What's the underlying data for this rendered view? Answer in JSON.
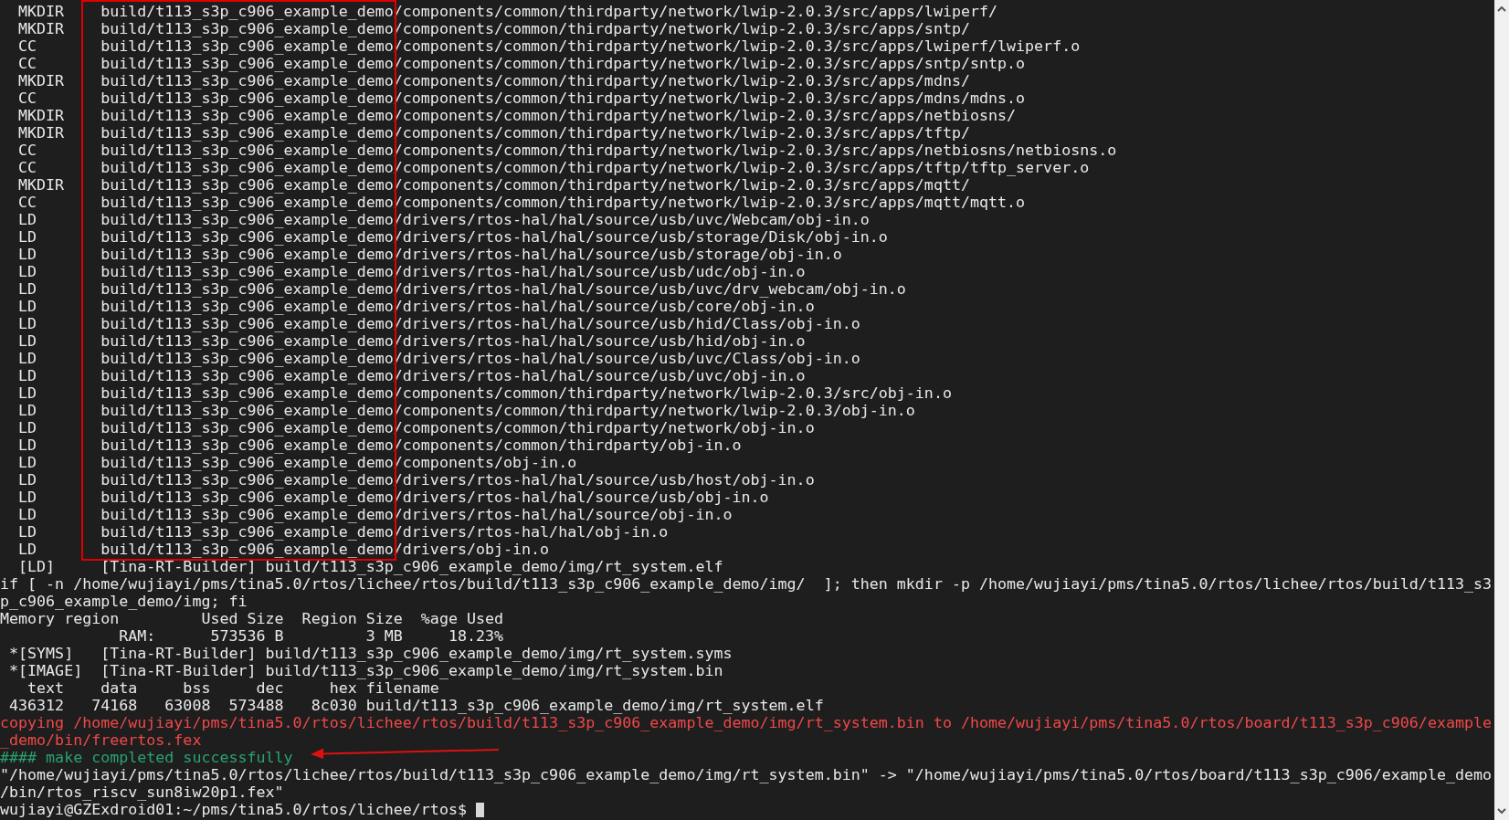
{
  "terminal": {
    "lines": [
      {
        "kind": "normal",
        "text": "  MKDIR    build/t113_s3p_c906_example_demo/components/common/thirdparty/network/lwip-2.0.3/src/apps/lwiperf/"
      },
      {
        "kind": "normal",
        "text": "  MKDIR    build/t113_s3p_c906_example_demo/components/common/thirdparty/network/lwip-2.0.3/src/apps/sntp/"
      },
      {
        "kind": "normal",
        "text": "  CC       build/t113_s3p_c906_example_demo/components/common/thirdparty/network/lwip-2.0.3/src/apps/lwiperf/lwiperf.o"
      },
      {
        "kind": "normal",
        "text": "  CC       build/t113_s3p_c906_example_demo/components/common/thirdparty/network/lwip-2.0.3/src/apps/sntp/sntp.o"
      },
      {
        "kind": "normal",
        "text": "  MKDIR    build/t113_s3p_c906_example_demo/components/common/thirdparty/network/lwip-2.0.3/src/apps/mdns/"
      },
      {
        "kind": "normal",
        "text": "  CC       build/t113_s3p_c906_example_demo/components/common/thirdparty/network/lwip-2.0.3/src/apps/mdns/mdns.o"
      },
      {
        "kind": "normal",
        "text": "  MKDIR    build/t113_s3p_c906_example_demo/components/common/thirdparty/network/lwip-2.0.3/src/apps/netbiosns/"
      },
      {
        "kind": "normal",
        "text": "  MKDIR    build/t113_s3p_c906_example_demo/components/common/thirdparty/network/lwip-2.0.3/src/apps/tftp/"
      },
      {
        "kind": "normal",
        "text": "  CC       build/t113_s3p_c906_example_demo/components/common/thirdparty/network/lwip-2.0.3/src/apps/netbiosns/netbiosns.o"
      },
      {
        "kind": "normal",
        "text": "  CC       build/t113_s3p_c906_example_demo/components/common/thirdparty/network/lwip-2.0.3/src/apps/tftp/tftp_server.o"
      },
      {
        "kind": "normal",
        "text": "  MKDIR    build/t113_s3p_c906_example_demo/components/common/thirdparty/network/lwip-2.0.3/src/apps/mqtt/"
      },
      {
        "kind": "normal",
        "text": "  CC       build/t113_s3p_c906_example_demo/components/common/thirdparty/network/lwip-2.0.3/src/apps/mqtt/mqtt.o"
      },
      {
        "kind": "normal",
        "text": "  LD       build/t113_s3p_c906_example_demo/drivers/rtos-hal/hal/source/usb/uvc/Webcam/obj-in.o"
      },
      {
        "kind": "normal",
        "text": "  LD       build/t113_s3p_c906_example_demo/drivers/rtos-hal/hal/source/usb/storage/Disk/obj-in.o"
      },
      {
        "kind": "normal",
        "text": "  LD       build/t113_s3p_c906_example_demo/drivers/rtos-hal/hal/source/usb/storage/obj-in.o"
      },
      {
        "kind": "normal",
        "text": "  LD       build/t113_s3p_c906_example_demo/drivers/rtos-hal/hal/source/usb/udc/obj-in.o"
      },
      {
        "kind": "normal",
        "text": "  LD       build/t113_s3p_c906_example_demo/drivers/rtos-hal/hal/source/usb/uvc/drv_webcam/obj-in.o"
      },
      {
        "kind": "normal",
        "text": "  LD       build/t113_s3p_c906_example_demo/drivers/rtos-hal/hal/source/usb/core/obj-in.o"
      },
      {
        "kind": "normal",
        "text": "  LD       build/t113_s3p_c906_example_demo/drivers/rtos-hal/hal/source/usb/hid/Class/obj-in.o"
      },
      {
        "kind": "normal",
        "text": "  LD       build/t113_s3p_c906_example_demo/drivers/rtos-hal/hal/source/usb/hid/obj-in.o"
      },
      {
        "kind": "normal",
        "text": "  LD       build/t113_s3p_c906_example_demo/drivers/rtos-hal/hal/source/usb/uvc/Class/obj-in.o"
      },
      {
        "kind": "normal",
        "text": "  LD       build/t113_s3p_c906_example_demo/drivers/rtos-hal/hal/source/usb/uvc/obj-in.o"
      },
      {
        "kind": "normal",
        "text": "  LD       build/t113_s3p_c906_example_demo/components/common/thirdparty/network/lwip-2.0.3/src/obj-in.o"
      },
      {
        "kind": "normal",
        "text": "  LD       build/t113_s3p_c906_example_demo/components/common/thirdparty/network/lwip-2.0.3/obj-in.o"
      },
      {
        "kind": "normal",
        "text": "  LD       build/t113_s3p_c906_example_demo/components/common/thirdparty/network/obj-in.o"
      },
      {
        "kind": "normal",
        "text": "  LD       build/t113_s3p_c906_example_demo/components/common/thirdparty/obj-in.o"
      },
      {
        "kind": "normal",
        "text": "  LD       build/t113_s3p_c906_example_demo/components/obj-in.o"
      },
      {
        "kind": "normal",
        "text": "  LD       build/t113_s3p_c906_example_demo/drivers/rtos-hal/hal/source/usb/host/obj-in.o"
      },
      {
        "kind": "normal",
        "text": "  LD       build/t113_s3p_c906_example_demo/drivers/rtos-hal/hal/source/usb/obj-in.o"
      },
      {
        "kind": "normal",
        "text": "  LD       build/t113_s3p_c906_example_demo/drivers/rtos-hal/hal/source/obj-in.o"
      },
      {
        "kind": "normal",
        "text": "  LD       build/t113_s3p_c906_example_demo/drivers/rtos-hal/hal/obj-in.o"
      },
      {
        "kind": "normal",
        "text": "  LD       build/t113_s3p_c906_example_demo/drivers/obj-in.o"
      },
      {
        "kind": "normal",
        "text": "  [LD]     [Tina-RT-Builder] build/t113_s3p_c906_example_demo/img/rt_system.elf"
      },
      {
        "kind": "normal",
        "text": "if [ -n /home/wujiayi/pms/tina5.0/rtos/lichee/rtos/build/t113_s3p_c906_example_demo/img/  ]; then mkdir -p /home/wujiayi/pms/tina5.0/rtos/lichee/rtos/build/t113_s3"
      },
      {
        "kind": "normal",
        "text": "p_c906_example_demo/img; fi"
      },
      {
        "kind": "normal",
        "text": "Memory region         Used Size  Region Size  %age Used"
      },
      {
        "kind": "normal",
        "text": "             RAM:      573536 B         3 MB     18.23%"
      },
      {
        "kind": "normal",
        "text": " *[SYMS]   [Tina-RT-Builder] build/t113_s3p_c906_example_demo/img/rt_system.syms"
      },
      {
        "kind": "normal",
        "text": " *[IMAGE]  [Tina-RT-Builder] build/t113_s3p_c906_example_demo/img/rt_system.bin"
      },
      {
        "kind": "normal",
        "text": "   text    data     bss     dec     hex filename"
      },
      {
        "kind": "normal",
        "text": " 436312   74168   63008  573488   8c030 build/t113_s3p_c906_example_demo/img/rt_system.elf"
      },
      {
        "kind": "error",
        "text": "copying /home/wujiayi/pms/tina5.0/rtos/lichee/rtos/build/t113_s3p_c906_example_demo/img/rt_system.bin to /home/wujiayi/pms/tina5.0/rtos/board/t113_s3p_c906/example"
      },
      {
        "kind": "error",
        "text": "_demo/bin/freertos.fex"
      },
      {
        "kind": "success",
        "text": "#### make completed successfully"
      },
      {
        "kind": "normal",
        "text": "\"/home/wujiayi/pms/tina5.0/rtos/lichee/rtos/build/t113_s3p_c906_example_demo/img/rt_system.bin\" -> \"/home/wujiayi/pms/tina5.0/rtos/board/t113_s3p_c906/example_demo"
      },
      {
        "kind": "normal",
        "text": "/bin/rtos_riscv_sun8iw20p1.fex\""
      },
      {
        "kind": "prompt",
        "text": "wujiayi@GZExdroid01:~/pms/tina5.0/rtos/lichee/rtos$ ",
        "cursor": true
      }
    ],
    "highlight_box": true,
    "arrow": true
  }
}
